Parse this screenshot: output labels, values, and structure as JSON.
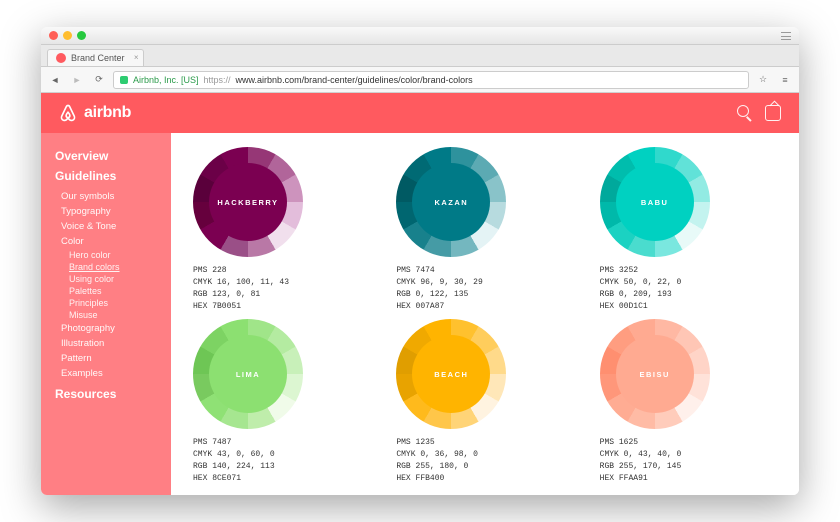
{
  "browser": {
    "tab_title": "Brand Center",
    "secure_label": "Airbnb, Inc. [US]",
    "url_scheme": "https://",
    "url_rest": "www.airbnb.com/brand-center/guidelines/color/brand-colors"
  },
  "header": {
    "brand": "airbnb"
  },
  "sidebar": {
    "section_overview": "Overview",
    "section_guidelines": "Guidelines",
    "items": {
      "our_symbols": "Our symbols",
      "typography": "Typography",
      "voice_tone": "Voice & Tone",
      "color": "Color",
      "photography": "Photography",
      "illustration": "Illustration",
      "pattern": "Pattern",
      "examples": "Examples"
    },
    "color_children": {
      "hero_color": "Hero color",
      "brand_colors": "Brand colors",
      "using_color": "Using color",
      "palettes": "Palettes",
      "principles": "Principles",
      "misuse": "Misuse"
    },
    "section_resources": "Resources"
  },
  "swatches": [
    {
      "name": "HACKBERRY",
      "core": "#7B0051",
      "ring": [
        "#5a003b",
        "#6b0047",
        "#7B0051",
        "#963776",
        "#b1659a",
        "#cd93bd",
        "#e3bddb",
        "#f1dfed",
        "#b978a6",
        "#9a4f87",
        "#7B0051",
        "#66003d"
      ],
      "specs": {
        "pms": "PMS 228",
        "cmyk": "CMYK 16, 100, 11, 43",
        "rgb": "RGB 123, 0, 81",
        "hex": "HEX 7B0051"
      }
    },
    {
      "name": "KAZAN",
      "core": "#007A87",
      "ring": [
        "#005a63",
        "#006a74",
        "#007A87",
        "#2e929d",
        "#5caab3",
        "#89c3c9",
        "#b7dbdf",
        "#e4f3f5",
        "#74b7bf",
        "#459ba5",
        "#18818c",
        "#006670"
      ],
      "specs": {
        "pms": "PMS 7474",
        "cmyk": "CMYK 96, 9, 30, 29",
        "rgb": "RGB 0, 122, 135",
        "hex": "HEX 007A87"
      }
    },
    {
      "name": "BABU",
      "core": "#00D1C1",
      "ring": [
        "#00a99c",
        "#00bdad",
        "#00D1C1",
        "#30d9cc",
        "#61e2d8",
        "#92ebe3",
        "#c3f3ef",
        "#e8faf8",
        "#7ae7df",
        "#4adcce",
        "#1bd2c2",
        "#00b9aa"
      ],
      "specs": {
        "pms": "PMS 3252",
        "cmyk": "CMYK 50, 0, 22, 0",
        "rgb": "RGB 0, 209, 193",
        "hex": "HEX 00D1C1"
      }
    },
    {
      "name": "LIMA",
      "core": "#8CE071",
      "ring": [
        "#6ec655",
        "#7dd363",
        "#8CE071",
        "#a0e589",
        "#b4eba1",
        "#c8f0b9",
        "#dcf6d1",
        "#f0fbe9",
        "#bfedab",
        "#a6e690",
        "#8fe175",
        "#79ca5f"
      ],
      "specs": {
        "pms": "PMS 7487",
        "cmyk": "CMYK 43, 0, 60, 0",
        "rgb": "RGB 140, 224, 113",
        "hex": "HEX 8CE071"
      }
    },
    {
      "name": "BEACH",
      "core": "#FFB400",
      "ring": [
        "#e09e00",
        "#f0a900",
        "#FFB400",
        "#ffc12e",
        "#ffcd5c",
        "#ffda8a",
        "#ffe7b8",
        "#fff3e0",
        "#ffd477",
        "#ffc649",
        "#ffba1c",
        "#e8a300"
      ],
      "specs": {
        "pms": "PMS 1235",
        "cmyk": "CMYK 0, 36, 98, 0",
        "rgb": "RGB 255, 180, 0",
        "hex": "HEX FFB400"
      }
    },
    {
      "name": "EBISU",
      "core": "#FFAA91",
      "ring": [
        "#ff8f70",
        "#ff9d80",
        "#FFAA91",
        "#ffb8a3",
        "#ffc6b5",
        "#ffd4c7",
        "#ffe2d9",
        "#fff0eb",
        "#ffccbb",
        "#ffbba5",
        "#ffac93",
        "#ff977a"
      ],
      "specs": {
        "pms": "PMS 1625",
        "cmyk": "CMYK 0, 43, 40, 0",
        "rgb": "RGB 255, 170, 145",
        "hex": "HEX FFAA91"
      }
    }
  ]
}
